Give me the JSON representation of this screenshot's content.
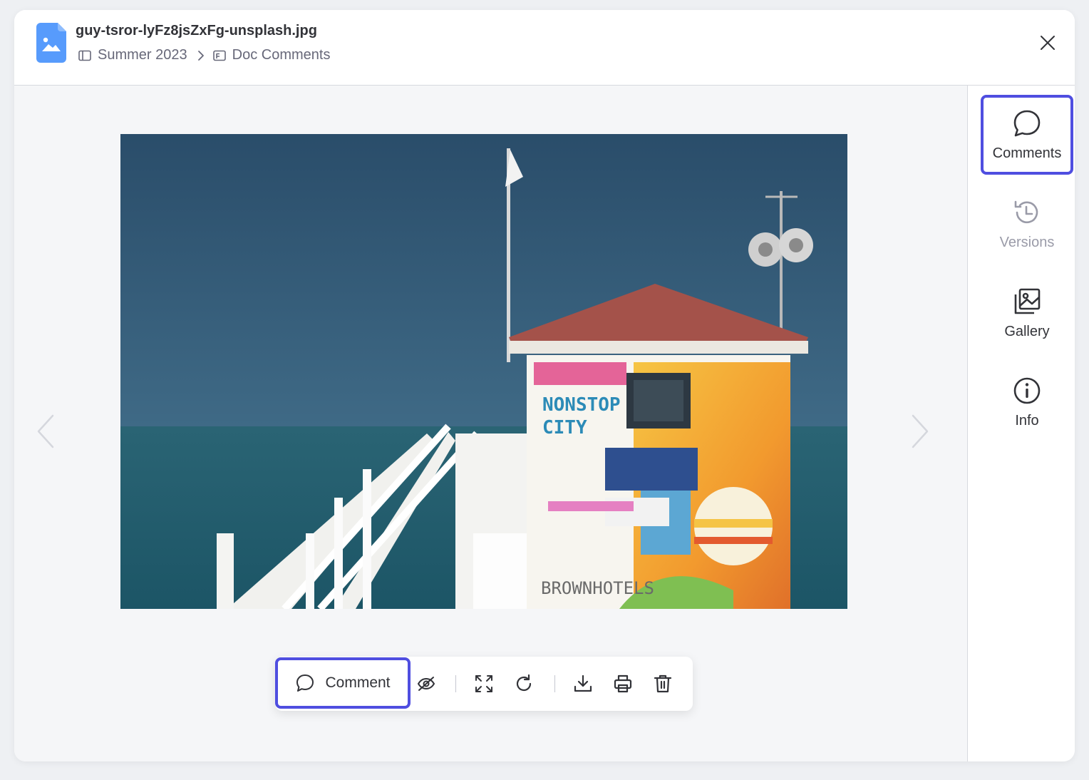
{
  "file": {
    "name": "guy-tsror-lyFz8jsZxFg-unsplash.jpg",
    "icon": "image-file-icon",
    "icon_color": "#579bfc"
  },
  "breadcrumb": {
    "workspace": "Summer 2023",
    "doc": "Doc Comments"
  },
  "toolbar": {
    "comment_label": "Comment",
    "tools": [
      "hide-icon",
      "fullscreen-icon",
      "rotate-icon",
      "download-icon",
      "print-icon",
      "trash-icon"
    ]
  },
  "sidebar": {
    "items": [
      {
        "label": "Comments",
        "icon": "comment-bubble-icon",
        "state": "active"
      },
      {
        "label": "Versions",
        "icon": "history-icon",
        "state": "disabled"
      },
      {
        "label": "Gallery",
        "icon": "gallery-icon",
        "state": "normal"
      },
      {
        "label": "Info",
        "icon": "info-icon",
        "state": "normal"
      }
    ]
  },
  "colors": {
    "accent": "#4f4ee0",
    "text": "#323338",
    "muted": "#676879"
  }
}
